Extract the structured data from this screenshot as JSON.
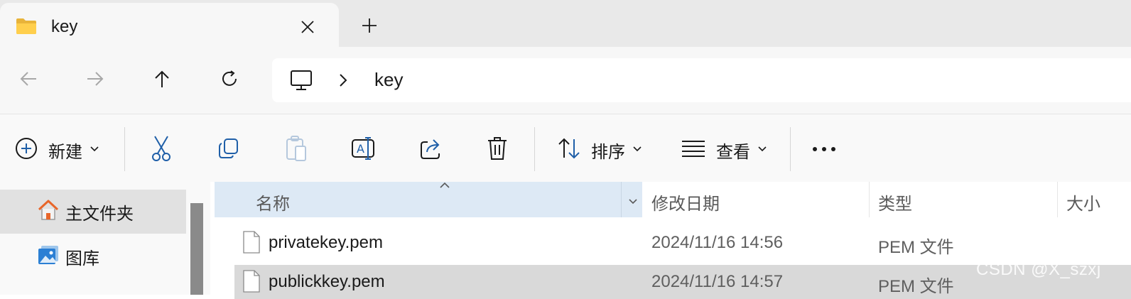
{
  "tab": {
    "title": "key",
    "close_icon": "close-icon",
    "new_tab_icon": "plus-icon"
  },
  "nav": {
    "back_icon": "arrow-left-icon",
    "forward_icon": "arrow-right-icon",
    "up_icon": "arrow-up-icon",
    "refresh_icon": "refresh-icon",
    "address": {
      "root_icon": "computer-icon",
      "crumb": "key"
    }
  },
  "toolbar": {
    "new_label": "新建",
    "sort_label": "排序",
    "view_label": "查看",
    "icons": [
      "plus-circle-icon",
      "cut-icon",
      "copy-icon",
      "paste-icon",
      "rename-icon",
      "share-icon",
      "delete-icon",
      "sort-icon",
      "view-icon",
      "more-icon"
    ]
  },
  "sidebar": {
    "items": [
      {
        "label": "主文件夹",
        "icon": "home-icon"
      },
      {
        "label": "图库",
        "icon": "gallery-icon"
      }
    ]
  },
  "list": {
    "columns": [
      "名称",
      "修改日期",
      "类型",
      "大小"
    ],
    "rows": [
      {
        "name": "privatekey.pem",
        "date": "2024/11/16 14:56",
        "type": "PEM 文件"
      },
      {
        "name": "publickkey.pem",
        "date": "2024/11/16 14:57",
        "type": "PEM 文件"
      }
    ]
  },
  "watermark": "CSDN @X_szxj",
  "colors": {
    "header_selected": "#dde9f5",
    "row_selected": "#d9d9d9",
    "accent": "#1f5fa8"
  }
}
